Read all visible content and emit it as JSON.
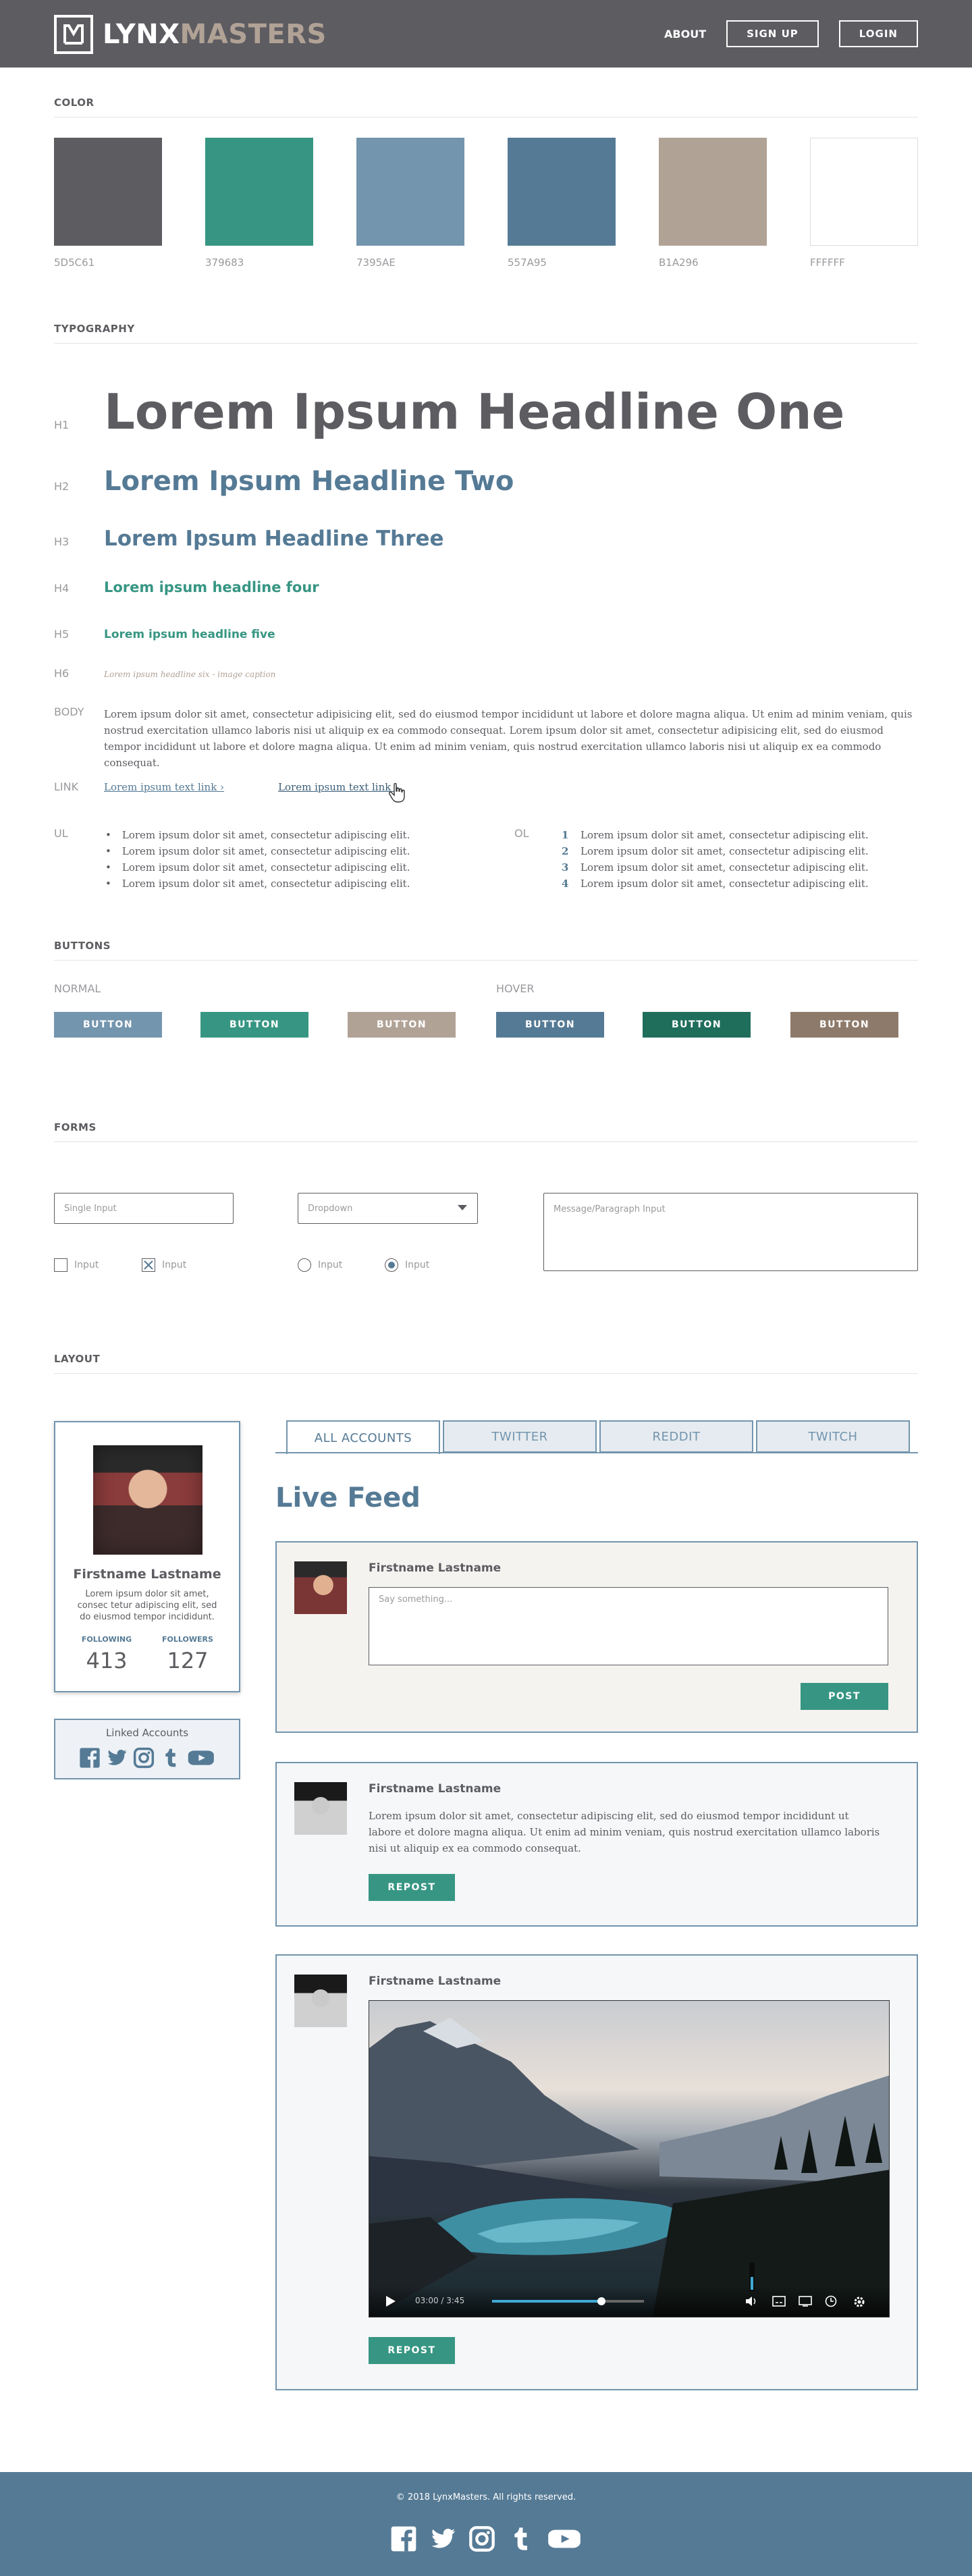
{
  "brand": {
    "part1": "LYNX",
    "part2": "MASTERS"
  },
  "nav": {
    "about": "ABOUT",
    "signup": "SIGN UP",
    "login": "LOGIN"
  },
  "sections": {
    "color": "COLOR",
    "typography": "TYPOGRAPHY",
    "buttons": "BUTTONS",
    "forms": "FORMS",
    "layout": "LAYOUT"
  },
  "colors": [
    {
      "hex": "#5D5C61",
      "label": "5D5C61"
    },
    {
      "hex": "#379683",
      "label": "379683"
    },
    {
      "hex": "#7395AE",
      "label": "7395AE"
    },
    {
      "hex": "#557A95",
      "label": "557A95"
    },
    {
      "hex": "#B1A296",
      "label": "B1A296"
    },
    {
      "hex": "#FFFFFF",
      "label": "FFFFFF"
    }
  ],
  "typography": {
    "h1": {
      "key": "H1",
      "text": "Lorem Ipsum Headline One"
    },
    "h2": {
      "key": "H2",
      "text": "Lorem Ipsum Headline Two"
    },
    "h3": {
      "key": "H3",
      "text": "Lorem Ipsum Headline Three"
    },
    "h4": {
      "key": "H4",
      "text": "Lorem ipsum headline four"
    },
    "h5": {
      "key": "H5",
      "text": "Lorem ipsum headline five"
    },
    "h6": {
      "key": "H6",
      "text": "Lorem ipsum headline six - image caption"
    },
    "body": {
      "key": "BODY",
      "text": "Lorem ipsum dolor sit amet, consectetur adipisicing elit, sed do eiusmod tempor incididunt ut labore et dolore magna aliqua. Ut enim ad minim veniam, quis nostrud exercitation ullamco laboris nisi ut aliquip ex ea commodo consequat. Lorem ipsum dolor sit amet, consectetur adipisicing elit, sed do eiusmod tempor incididunt ut labore et dolore magna aliqua. Ut enim ad minim veniam, quis nostrud exercitation ullamco laboris nisi ut aliquip ex ea commodo consequat."
    },
    "link": {
      "key": "LINK",
      "normal": "Lorem ipsum text link ›",
      "hover": "Lorem ipsum text link ›"
    },
    "ul": {
      "key": "UL",
      "items": [
        "Lorem ipsum dolor sit amet, consectetur adipiscing elit.",
        "Lorem ipsum dolor sit amet, consectetur adipiscing elit.",
        "Lorem ipsum dolor sit amet, consectetur adipiscing elit.",
        "Lorem ipsum dolor sit amet, consectetur adipiscing elit."
      ]
    },
    "ol": {
      "key": "OL",
      "items": [
        {
          "n": "1",
          "t": "Lorem ipsum dolor sit amet, consectetur adipiscing elit."
        },
        {
          "n": "2",
          "t": "Lorem ipsum dolor sit amet, consectetur adipiscing elit."
        },
        {
          "n": "3",
          "t": "Lorem ipsum dolor sit amet, consectetur adipiscing elit."
        },
        {
          "n": "4",
          "t": "Lorem ipsum dolor sit amet, consectetur adipiscing elit."
        }
      ]
    }
  },
  "buttons": {
    "normal_label": "NORMAL",
    "hover_label": "HOVER",
    "text": "BUTTON",
    "normal_colors": [
      "#7395AE",
      "#379683",
      "#B1A296"
    ],
    "hover_colors": [
      "#557A95",
      "#1F6E5C",
      "#8E7A6A"
    ]
  },
  "forms": {
    "single_placeholder": "Single Input",
    "dropdown_value": "Dropdown",
    "message_placeholder": "Message/Paragraph Input",
    "checkbox_label": "Input",
    "radio_label": "Input"
  },
  "profile": {
    "name": "Firstname Lastname",
    "bio": "Lorem ipsum dolor sit amet, consec tetur adipiscing elit, sed do eiusmod tempor incididunt.",
    "following_label": "FOLLOWING",
    "following": "413",
    "followers_label": "FOLLOWERS",
    "followers": "127"
  },
  "linked": {
    "title": "Linked Accounts"
  },
  "tabs": [
    "ALL ACCOUNTS",
    "TWITTER",
    "REDDIT",
    "TWITCH"
  ],
  "feed": {
    "title": "Live Feed",
    "composer": {
      "name": "Firstname Lastname",
      "placeholder": "Say something...",
      "post": "POST"
    },
    "post1": {
      "name": "Firstname Lastname",
      "text": "Lorem ipsum dolor sit amet, consectetur adipiscing elit, sed do eiusmod tempor incididunt ut labore et dolore magna aliqua. Ut enim ad minim veniam, quis nostrud exercitation ullamco laboris nisi ut aliquip ex ea commodo consequat.",
      "repost": "REPOST"
    },
    "post2": {
      "name": "Firstname Lastname",
      "time": "03:00 / 3:45",
      "repost": "REPOST",
      "progress": 0.72,
      "volume": 0.5
    }
  },
  "footer": {
    "copyright": "© 2018 LynxMasters. All rights reserved."
  },
  "icons": [
    "facebook-icon",
    "twitter-icon",
    "instagram-icon",
    "tumblr-icon",
    "youtube-icon"
  ]
}
